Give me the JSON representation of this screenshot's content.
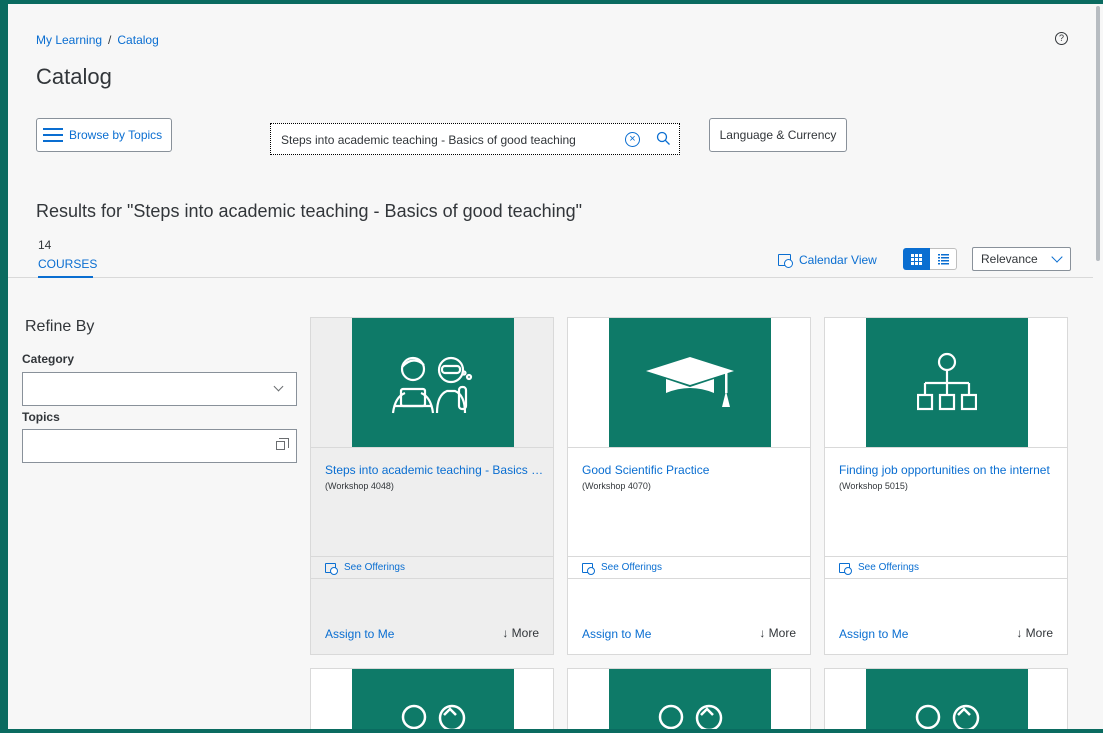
{
  "breadcrumb": {
    "home": "My Learning",
    "separator": "/",
    "current": "Catalog"
  },
  "help_icon": "?",
  "page_title": "Catalog",
  "toolbar": {
    "browse_label": "Browse by Topics",
    "search_value": "Steps into academic teaching - Basics of good teaching",
    "language_label": "Language & Currency"
  },
  "results": {
    "title": "Results for \"Steps into academic teaching - Basics of good teaching\"",
    "count": "14",
    "tab_label": "COURSES",
    "calendar_view": "Calendar View",
    "sort_value": "Relevance"
  },
  "refine": {
    "title": "Refine By",
    "category_label": "Category",
    "topics_label": "Topics"
  },
  "cards": [
    {
      "title": "Steps into academic teaching - Basics of good teaching",
      "subtitle": "(Workshop 4048)",
      "offerings": "See Offerings",
      "assign": "Assign to Me",
      "more": "More",
      "icon": "students-icon"
    },
    {
      "title": "Good Scientific Practice",
      "subtitle": "(Workshop 4070)",
      "offerings": "See Offerings",
      "assign": "Assign to Me",
      "more": "More",
      "icon": "graduation-cap-icon"
    },
    {
      "title": "Finding job opportunities on the internet",
      "subtitle": "(Workshop 5015)",
      "offerings": "See Offerings",
      "assign": "Assign to Me",
      "more": "More",
      "icon": "org-chart-icon"
    }
  ],
  "colors": {
    "brand": "#0a6b60",
    "tile": "#0e7a68",
    "link": "#0a6ed1"
  }
}
